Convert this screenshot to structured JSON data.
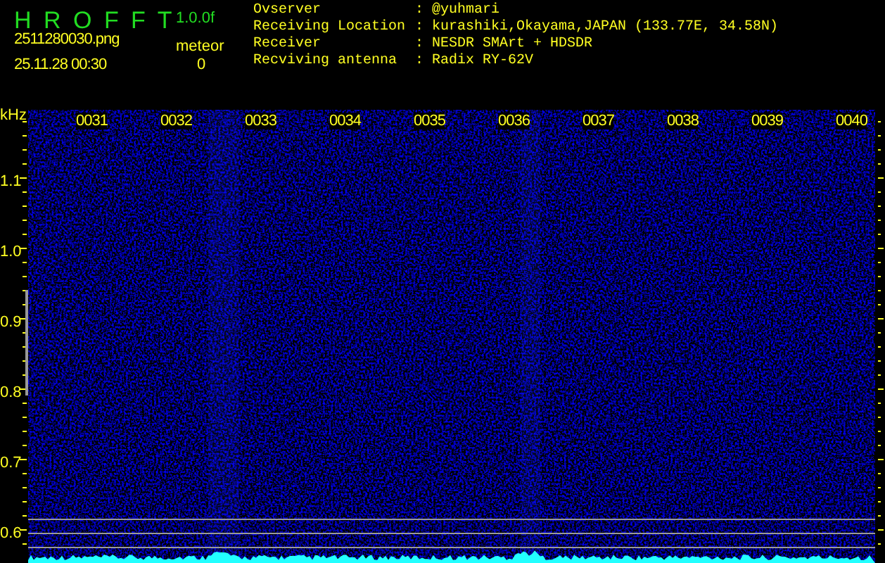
{
  "app": {
    "title": "H R O F F T",
    "version": "1.0.0f"
  },
  "file": {
    "name": "2511280030.png",
    "datetime": "25.11.28 00:30"
  },
  "meteor": {
    "label": "meteor",
    "count": "0"
  },
  "info": [
    {
      "label": "Ovserver",
      "colon": ":",
      "value": "@yuhmari"
    },
    {
      "label": "Receiving Location",
      "colon": ":",
      "value": "kurashiki,Okayama,JAPAN (133.77E, 34.58N)"
    },
    {
      "label": "Receiver",
      "colon": ":",
      "value": "NESDR SMArt + HDSDR"
    },
    {
      "label": "Recviving antenna",
      "colon": ":",
      "value": "Radix RY-62V"
    }
  ],
  "spectrogram": {
    "unit": "kHz",
    "time_labels": [
      "0031",
      "0032",
      "0033",
      "0034",
      "0035",
      "0036",
      "0037",
      "0038",
      "0039",
      "0040"
    ],
    "freq_labels": [
      "1.1",
      "1.0",
      "0.9",
      "0.8",
      "0.7",
      "0.6"
    ]
  }
}
